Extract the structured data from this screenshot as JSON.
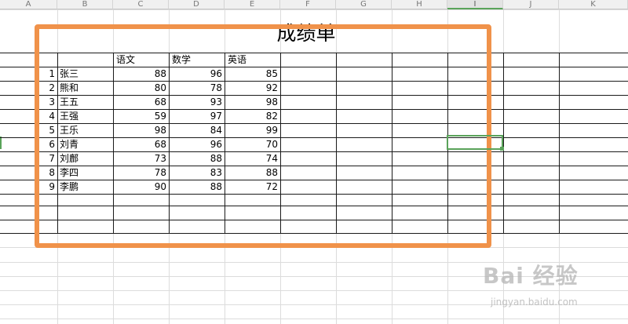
{
  "spreadsheet": {
    "columns": [
      "A",
      "B",
      "C",
      "D",
      "E",
      "F",
      "G",
      "H",
      "I",
      "J",
      "K"
    ],
    "selected_column": "I",
    "title": "成绩单",
    "headers": [
      "语文",
      "数学",
      "英语"
    ],
    "rows": [
      {
        "no": "1",
        "name": "张三",
        "chinese": "88",
        "math": "96",
        "english": "85"
      },
      {
        "no": "2",
        "name": "熊和",
        "chinese": "80",
        "math": "78",
        "english": "92"
      },
      {
        "no": "3",
        "name": "王五",
        "chinese": "68",
        "math": "93",
        "english": "98"
      },
      {
        "no": "4",
        "name": "王强",
        "chinese": "59",
        "math": "97",
        "english": "82"
      },
      {
        "no": "5",
        "name": "王乐",
        "chinese": "98",
        "math": "84",
        "english": "99"
      },
      {
        "no": "6",
        "name": "刘青",
        "chinese": "68",
        "math": "96",
        "english": "70"
      },
      {
        "no": "7",
        "name": "刘鄜",
        "chinese": "73",
        "math": "88",
        "english": "74"
      },
      {
        "no": "8",
        "name": "李四",
        "chinese": "78",
        "math": "83",
        "english": "88"
      },
      {
        "no": "9",
        "name": "李鹏",
        "chinese": "90",
        "math": "88",
        "english": "72"
      }
    ]
  },
  "watermark": {
    "main": "Bai 经验",
    "sub": "jingyan.baidu.com"
  },
  "colors": {
    "highlight_frame": "#f0924a",
    "selection": "#5aa35a"
  }
}
